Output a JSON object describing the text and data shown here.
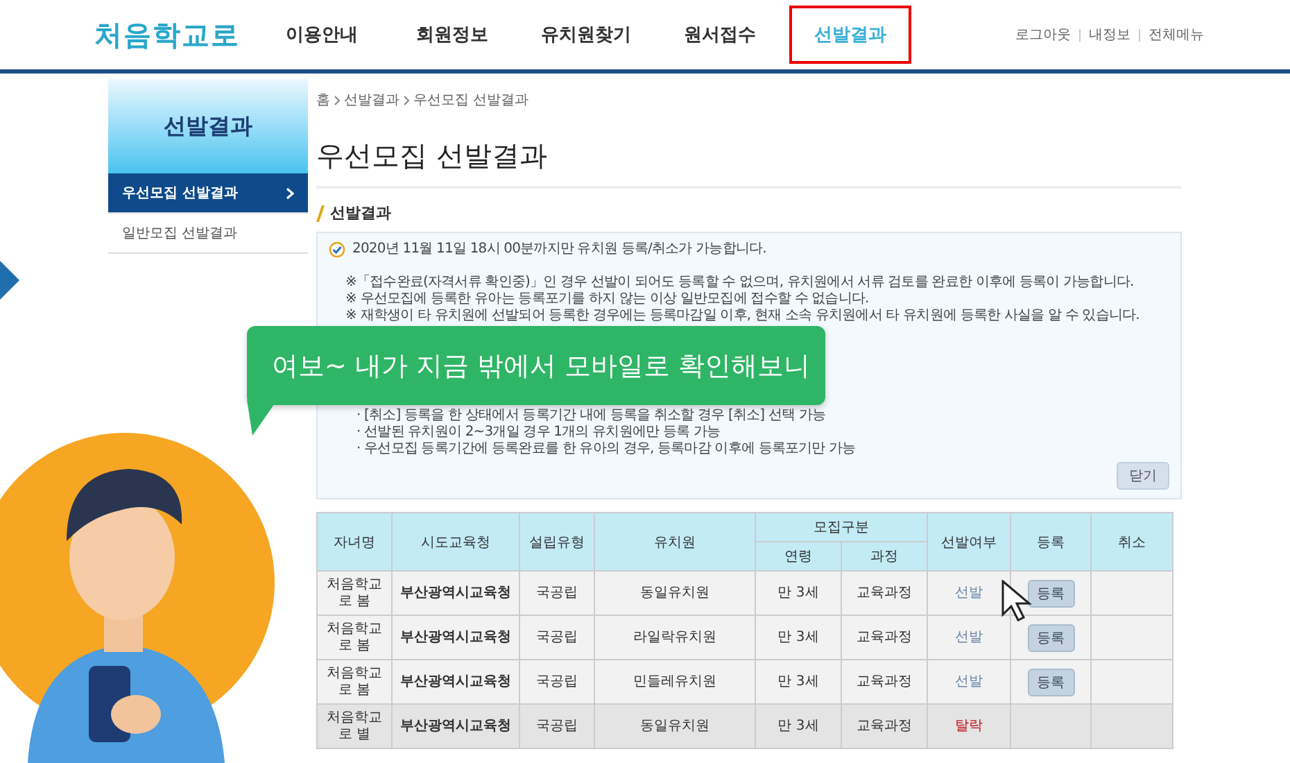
{
  "header": {
    "logo": "처음학교로",
    "nav": [
      {
        "label": "이용안내",
        "selected": false
      },
      {
        "label": "회원정보",
        "selected": false
      },
      {
        "label": "유치원찾기",
        "selected": false
      },
      {
        "label": "원서접수",
        "selected": false
      },
      {
        "label": "선발결과",
        "selected": true
      }
    ],
    "util_links": [
      "로그아웃",
      "내정보",
      "전체메뉴"
    ]
  },
  "sidebar": {
    "title": "선발결과",
    "items": [
      {
        "label": "우선모집 선발결과",
        "selected": true
      },
      {
        "label": "일반모집 선발결과",
        "selected": false
      }
    ]
  },
  "breadcrumb": [
    "홈",
    "선발결과",
    "우선모집 선발결과"
  ],
  "page_title": "우선모집 선발결과",
  "section_title": "선발결과",
  "notice": {
    "headline": "2020년 11월 11일 18시 00분까지만 유치원 등록/취소가 가능합니다.",
    "notes": [
      "※「접수완료(자격서류 확인중)」인 경우 선발이 되어도 등록할 수 없으며, 유치원에서 서류 검토를 완료한 이후에 등록이 가능합니다.",
      "※ 우선모집에 등록한 유아는 등록포기를 하지 않는 이상 일반모집에 접수할 수 없습니다.",
      "※ 재학생이 타 유치원에 선발되어 등록한 경우에는 등록마감일 이후, 현재 소속 유치원에서 타 유치원에 등록한 사실을 알 수 있습니다."
    ],
    "bullets": [
      "· [취소] 등록을 한 상태에서 등록기간 내에 등록을 취소할 경우 [취소] 선택 가능",
      "· 선발된 유치원이 2~3개일 경우 1개의 유치원에만 등록 가능",
      "· 우선모집 등록기간에 등록완료를 한 유아의 경우, 등록마감 이후에 등록포기만 가능"
    ],
    "close_button": "닫기"
  },
  "table": {
    "columns": {
      "child": "자녀명",
      "office": "시도교육청",
      "type": "설립유형",
      "kindergarten": "유치원",
      "group": "모집구분",
      "age": "연령",
      "course": "과정",
      "result": "선발여부",
      "register": "등록",
      "cancel": "취소"
    },
    "rows": [
      {
        "child": "처음학교로 봄",
        "office": "부산광역시교육청",
        "type": "국공립",
        "kindergarten": "동일유치원",
        "age": "만 3세",
        "course": "교육과정",
        "result": {
          "text": "선발",
          "kind": "pass"
        },
        "register": "등록"
      },
      {
        "child": "처음학교로 봄",
        "office": "부산광역시교육청",
        "type": "국공립",
        "kindergarten": "라일락유치원",
        "age": "만 3세",
        "course": "교육과정",
        "result": {
          "text": "선발",
          "kind": "pass"
        },
        "register": "등록"
      },
      {
        "child": "처음학교로 봄",
        "office": "부산광역시교육청",
        "type": "국공립",
        "kindergarten": "민들레유치원",
        "age": "만 3세",
        "course": "교육과정",
        "result": {
          "text": "선발",
          "kind": "pass"
        },
        "register": "등록"
      },
      {
        "child": "처음학교로 별",
        "office": "부산광역시교육청",
        "type": "국공립",
        "kindergarten": "동일유치원",
        "age": "만 3세",
        "course": "교육과정",
        "result": {
          "text": "탈락",
          "kind": "fail"
        }
      }
    ]
  },
  "caption": "여보~ 내가 지금 밖에서 모바일로 확인해보니"
}
